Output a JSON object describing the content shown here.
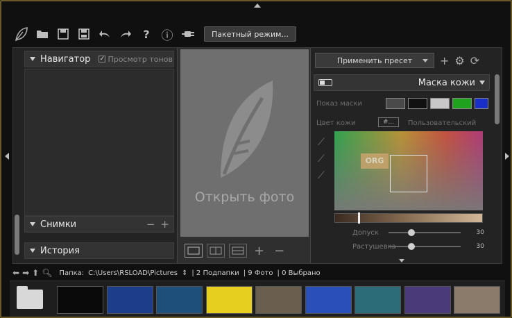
{
  "toolbar": {
    "icons": [
      "leaf-logo-icon",
      "open-folder-icon",
      "save-icon",
      "save-as-icon",
      "undo-icon",
      "redo-icon",
      "help-icon",
      "info-icon",
      "plugin-icon"
    ],
    "help_label": "?",
    "info_label": "ⓘ",
    "batch_label": "Пакетный режим..."
  },
  "left_panel": {
    "navigator": {
      "title": "Навигатор",
      "preview_label": "Просмотр тонов"
    },
    "snapshots": {
      "title": "Снимки",
      "minus": "−",
      "plus": "+"
    },
    "history": {
      "title": "История"
    }
  },
  "center": {
    "open_photo": "Открыть фото",
    "zoom_plus": "+",
    "zoom_minus": "−"
  },
  "right_panel": {
    "preset_label": "Применить пресет",
    "preset_add": "+",
    "mask_title": "Маска кожи",
    "mask_color_label": "Показ маски",
    "mask_swatches": [
      "#4a4a4a",
      "#111111",
      "#c8c8c8",
      "#1fa31f",
      "#1a2fc8"
    ],
    "skin_color_label": "Цвет кожи",
    "hex_label": "#...",
    "color_label": "Пользовательский",
    "orig_label": "ORG",
    "sliders": [
      {
        "label": "Допуск",
        "value": "30",
        "position": 0.27
      },
      {
        "label": "Растушевка",
        "value": "30",
        "position": 0.27
      }
    ]
  },
  "pathbar": {
    "folder_label": "Папка:",
    "path": "C:\\Users\\RSLOAD\\Pictures",
    "subfolders": "| 2 Подпапки",
    "photos": "| 9 Фото",
    "selected": "| 0 Выбрано"
  },
  "filmstrip": {
    "thumbnails": [
      {
        "name": "pacman-thumb",
        "color": "#0a0a0a"
      },
      {
        "name": "blue-figure-thumb",
        "color": "#1b3d8a"
      },
      {
        "name": "blue-light-thumb",
        "color": "#1d4f7a"
      },
      {
        "name": "yellow-thumb",
        "color": "#e6cf1e"
      },
      {
        "name": "landscape-thumb",
        "color": "#6a5e4e"
      },
      {
        "name": "mario-thumb",
        "color": "#2a4fb8"
      },
      {
        "name": "teal-thumb",
        "color": "#2c6b78"
      },
      {
        "name": "space-thumb",
        "color": "#4b3a7a"
      },
      {
        "name": "city-thumb",
        "color": "#8a7b6a"
      }
    ]
  }
}
